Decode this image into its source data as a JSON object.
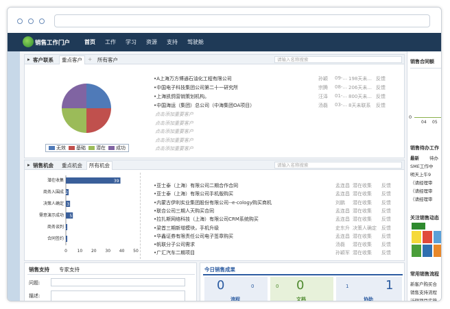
{
  "colors": {
    "nav_bg": "#1f3a57",
    "bar": "#3a5f9a",
    "pie_blue": "#4f7ab8",
    "pie_red": "#c0504d",
    "pie_green": "#9bbb59",
    "pie_purple": "#8064a2"
  },
  "nav": {
    "logo_text": "销售工作门户",
    "items": [
      "首页",
      "工作",
      "学习",
      "资源",
      "支持",
      "驾驶舱"
    ],
    "active": "首页"
  },
  "customers": {
    "title": "客户联系",
    "tabs": [
      "重点客户",
      "所有客户"
    ],
    "search_placeholder": "请输入名称搜索",
    "rows": [
      {
        "name": "•A上海万方博通石油化工程有限公司",
        "owner": "孙颖",
        "date": "09-...",
        "note": "198天未...",
        "status": "反馈"
      },
      {
        "name": "•中国电子科技集团公司第二十一研究所",
        "owner": "宗腾",
        "date": "08-...",
        "note": "206天未...",
        "status": "反馈"
      },
      {
        "name": "•上海凯鸽营销策划机构。",
        "owner": "汪泽",
        "date": "01-...",
        "note": "800天未...",
        "status": "反馈"
      },
      {
        "name": "•中国海运（集团）总公司（中海集团OA项目）",
        "owner": "汤磊",
        "date": "03-...",
        "note": "8天未联系",
        "status": "反馈"
      }
    ],
    "empty_text": "点击添加重要客户",
    "legend": [
      "无效",
      "基础",
      "潜在",
      "成功"
    ]
  },
  "chart_data": {
    "type": "bar",
    "categories": [
      "潜在收集",
      "商务入围成",
      "决策人确定",
      "需意演示成功",
      "商务谈判",
      "合同签约"
    ],
    "values": [
      39,
      2,
      3,
      5,
      1,
      1
    ],
    "xlim": [
      0,
      50
    ],
    "xticks": [
      "0",
      "10",
      "20",
      "30",
      "40",
      "50"
    ],
    "labels": [
      "39",
      "2",
      "3",
      "5",
      "1",
      "1"
    ]
  },
  "pie": {
    "values": [
      0.25,
      0.25,
      0.25,
      0.25
    ]
  },
  "opportunities": {
    "title": "销售机会",
    "tabs": [
      "重点机会",
      "所有机会"
    ],
    "search_placeholder": "请输入名称搜索",
    "rows": [
      {
        "name": "•亚士泰（上海）有限公司二期合作合同",
        "owner": "孟连昌",
        "stage": "潜在收集",
        "status": "反馈"
      },
      {
        "name": "•亚士泰（上海）有限公司手机版购买",
        "owner": "孟连昌",
        "stage": "潜在收集",
        "status": "反馈"
      },
      {
        "name": "•内蒙古伊利实业集团股份有限公司--e-cology购买商机",
        "owner": "刘鹏",
        "stage": "潜在收集",
        "status": "反馈"
      },
      {
        "name": "•联合公司三期人天购买合同",
        "owner": "孟连昌",
        "stage": "潜在收集",
        "status": "反馈"
      },
      {
        "name": "•拉扎斯网络科技（上海）有限公司CRM系统购买",
        "owner": "孟连昌",
        "stage": "潜在收集",
        "status": "反馈"
      },
      {
        "name": "•梁首三期新增模块，手机升级",
        "owner": "史东升",
        "stage": "决策人确定",
        "status": "反馈"
      },
      {
        "name": "•华鑫证券有限责任公司电子签章购买",
        "owner": "孟连昌",
        "stage": "潜在收集",
        "status": "反馈"
      },
      {
        "name": "•帆联分子公司需求",
        "owner": "汤磊",
        "stage": "潜在收集",
        "status": "反馈"
      },
      {
        "name": "•广汇汽车二期项目",
        "owner": "孙颖军",
        "stage": "潜在收集",
        "status": "反馈"
      }
    ]
  },
  "support": {
    "tabs": [
      "销售支持",
      "专家支持"
    ],
    "question_label": "问题:",
    "desc_label": "描述:"
  },
  "today": {
    "title": "今日销售成果",
    "stats": [
      {
        "big": "0",
        "small": "0",
        "label": "流程"
      },
      {
        "big": "0",
        "small": "0",
        "label": "文档"
      },
      {
        "big": "1",
        "small": "1",
        "label": "协助"
      }
    ]
  },
  "right": {
    "contract_title": "销售合同额",
    "axis_zero": "0",
    "axis_months": [
      "04",
      "05"
    ],
    "todo_title": "销售待办工作",
    "todo_tabs": [
      "最新",
      "待办"
    ],
    "todo_items": [
      "SME工作中",
      "明天上午9",
      "（请经理审",
      "（请经理审",
      "（请经理审"
    ],
    "news_title": "关注销售动态",
    "flow_title": "常用销售流程",
    "flow_items": [
      "新客户购买合",
      "销售支持流程",
      "泛微项目实施"
    ]
  }
}
